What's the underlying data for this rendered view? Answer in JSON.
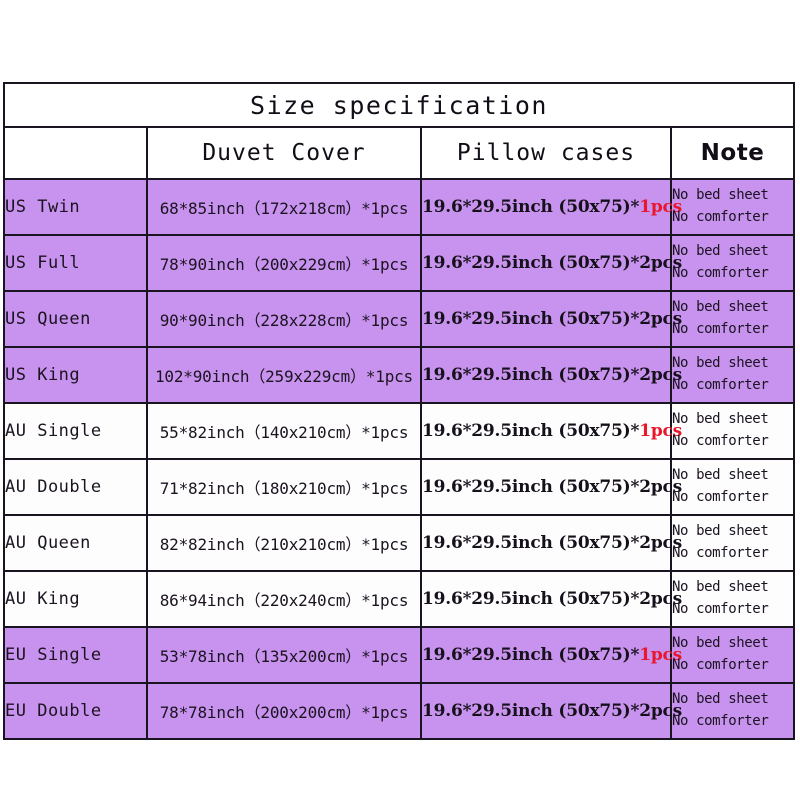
{
  "table": {
    "title": "Size specification",
    "columns": [
      {
        "key": "size",
        "label": ""
      },
      {
        "key": "duvet",
        "label": "Duvet Cover"
      },
      {
        "key": "pillow",
        "label": "Pillow cases"
      },
      {
        "key": "note",
        "label": "Note"
      }
    ],
    "note_lines": [
      "No bed sheet",
      "No comforter"
    ],
    "colors": {
      "purple_row": "#c893ee",
      "white_row": "#fdfdfd",
      "border": "#1a1420",
      "highlight_red": "#e8172b",
      "text": "#1b1320"
    },
    "rows": [
      {
        "size": "US Twin",
        "duvet": "68*85inch（172x218cm）*1pcs",
        "pillow_main": "19.6*29.5inch (50x75)*",
        "pillow_qty": "1pcs",
        "pillow_qty_red": true,
        "note": [
          "No bed sheet",
          "No comforter"
        ],
        "shade": "purple"
      },
      {
        "size": "US Full",
        "duvet": "78*90inch（200x229cm）*1pcs",
        "pillow_main": "19.6*29.5inch (50x75)*",
        "pillow_qty": "2pcs",
        "pillow_qty_red": false,
        "note": [
          "No bed sheet",
          "No comforter"
        ],
        "shade": "purple"
      },
      {
        "size": "US Queen",
        "duvet": "90*90inch（228x228cm）*1pcs",
        "pillow_main": "19.6*29.5inch (50x75)*",
        "pillow_qty": "2pcs",
        "pillow_qty_red": false,
        "note": [
          "No bed sheet",
          "No comforter"
        ],
        "shade": "purple"
      },
      {
        "size": "US King",
        "duvet": "102*90inch（259x229cm）*1pcs",
        "pillow_main": "19.6*29.5inch (50x75)*",
        "pillow_qty": "2pcs",
        "pillow_qty_red": false,
        "note": [
          "No bed sheet",
          "No comforter"
        ],
        "shade": "purple"
      },
      {
        "size": "AU Single",
        "duvet": "55*82inch（140x210cm）*1pcs",
        "pillow_main": "19.6*29.5inch (50x75)*",
        "pillow_qty": "1pcs",
        "pillow_qty_red": true,
        "note": [
          "No bed sheet",
          "No comforter"
        ],
        "shade": "white"
      },
      {
        "size": "AU Double",
        "duvet": "71*82inch（180x210cm）*1pcs",
        "pillow_main": "19.6*29.5inch (50x75)*",
        "pillow_qty": "2pcs",
        "pillow_qty_red": false,
        "note": [
          "No bed sheet",
          "No comforter"
        ],
        "shade": "white"
      },
      {
        "size": "AU Queen",
        "duvet": "82*82inch（210x210cm）*1pcs",
        "pillow_main": "19.6*29.5inch (50x75)*",
        "pillow_qty": "2pcs",
        "pillow_qty_red": false,
        "note": [
          "No bed sheet",
          "No comforter"
        ],
        "shade": "white"
      },
      {
        "size": "AU King",
        "duvet": "86*94inch（220x240cm）*1pcs",
        "pillow_main": "19.6*29.5inch (50x75)*",
        "pillow_qty": "2pcs",
        "pillow_qty_red": false,
        "note": [
          "No bed sheet",
          "No comforter"
        ],
        "shade": "white"
      },
      {
        "size": "EU Single",
        "duvet": "53*78inch（135x200cm）*1pcs",
        "pillow_main": "19.6*29.5inch (50x75)*",
        "pillow_qty": "1pcs",
        "pillow_qty_red": true,
        "note": [
          "No bed sheet",
          "No comforter"
        ],
        "shade": "purple"
      },
      {
        "size": "EU Double",
        "duvet": "78*78inch（200x200cm）*1pcs",
        "pillow_main": "19.6*29.5inch (50x75)*",
        "pillow_qty": "2pcs",
        "pillow_qty_red": false,
        "note": [
          "No bed sheet",
          "No comforter"
        ],
        "shade": "purple"
      }
    ]
  }
}
